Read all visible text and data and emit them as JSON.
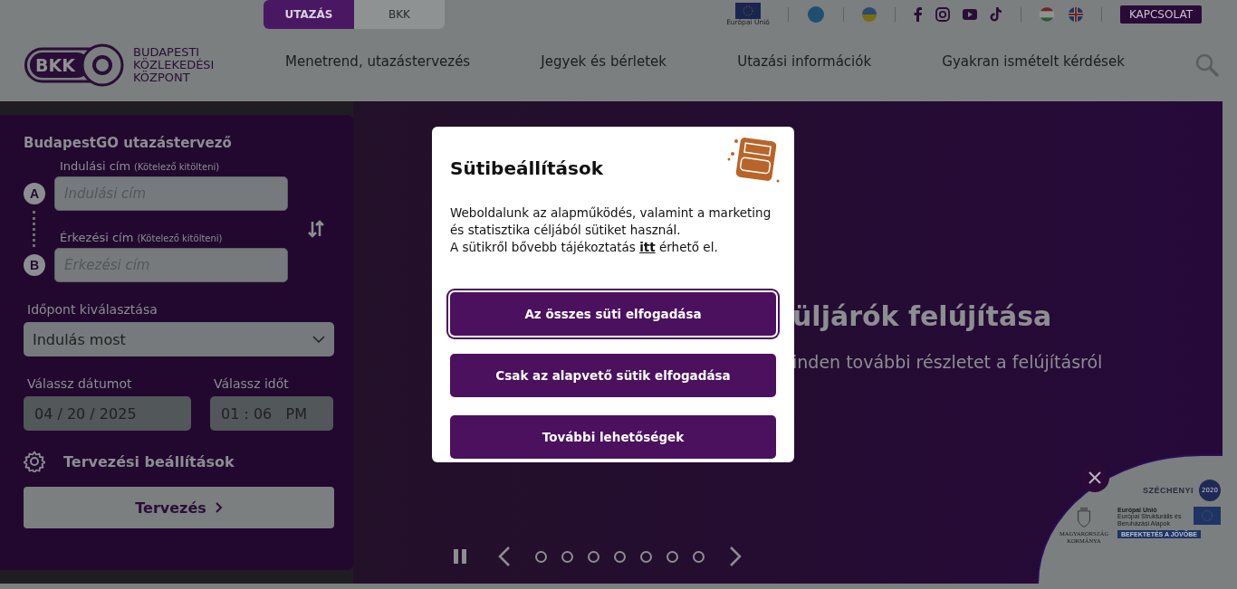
{
  "top_tabs": [
    {
      "label": "UTAZÁS",
      "selected": true
    },
    {
      "label": "BKK",
      "selected": false
    }
  ],
  "eu_label": "Európai Unió",
  "contact_button": "KAPCSOLAT",
  "logo": {
    "mark": "BKK",
    "name_lines": [
      "BUDAPESTI",
      "KÖZLEKEDÉSI",
      "KÖZPONT"
    ]
  },
  "nav": [
    "Menetrend, utazástervezés",
    "Jegyek és bérletek",
    "Utazási információk",
    "Gyakran ismételt kérdések"
  ],
  "planner": {
    "title": "BudapestGO utazástervező",
    "from": {
      "badge": "A",
      "label": "Indulási cím",
      "hint": "(Kötelező kitölteni)",
      "placeholder": "Indulási cím"
    },
    "to": {
      "badge": "B",
      "label": "Érkezési cím",
      "hint": "(Kötelező kitölteni)",
      "placeholder": "Érkezési cím"
    },
    "time_label": "Időpont kiválasztása",
    "time_value": "Indulás most",
    "date_label": "Válassz dátumot",
    "date_value": "04 / 20 / 2025",
    "clock_label": "Válassz időt",
    "clock_value": "01 : 06   PM",
    "settings": "Tervezési beállítások",
    "submit": "Tervezés"
  },
  "hero": {
    "title": "üljárók felújítása",
    "subtitle": "inden további részletet a felújításról"
  },
  "slides": [
    {
      "selected": false
    },
    {
      "selected": false
    },
    {
      "selected": false
    },
    {
      "selected": false
    },
    {
      "selected": false
    },
    {
      "selected": false
    },
    {
      "selected": false
    }
  ],
  "cookie_dialog": {
    "title": "Sütibeállítások",
    "text": "Weboldalunk az alapműködés, valamint a marketing és statisztika céljából sütiket használ.",
    "info": "A sütikről bővebb tájékoztatás",
    "link": "itt",
    "info_end": "érhető el.",
    "buttons": [
      {
        "label": "Az összes süti elfogadása",
        "focused": true
      },
      {
        "label": "Csak az alapvető sütik elfogadása",
        "focused": false
      },
      {
        "label": "További lehetőségek",
        "focused": false
      }
    ]
  },
  "szechenyi": {
    "title": "SZÉCHENYI",
    "year": "2020",
    "gov": "MAGYARORSZÁG KORMÁNYA",
    "eu": "Európai Unió",
    "funds": "Európai Strukturális és Beruházási Alapok",
    "slogan": "BEFEKTETÉS A JÖVŐBE"
  }
}
